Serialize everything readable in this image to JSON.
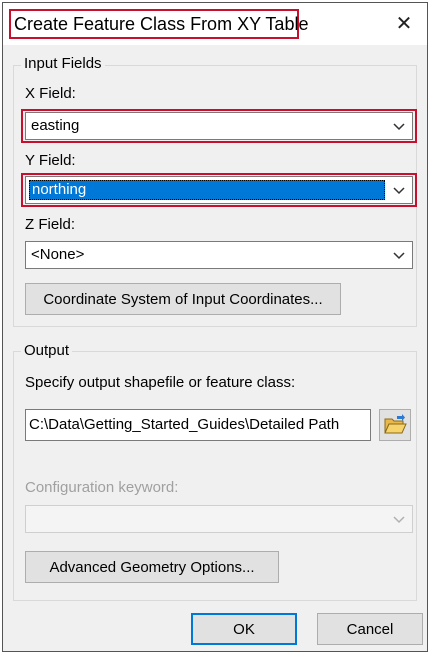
{
  "dialog": {
    "title": "Create Feature Class From XY Table",
    "close_glyph": "✕",
    "close_icon": "close-icon"
  },
  "input_fields": {
    "legend": "Input Fields",
    "x_field": {
      "label": "X Field:",
      "value": "easting"
    },
    "y_field": {
      "label": "Y Field:",
      "value": "northing"
    },
    "z_field": {
      "label": "Z Field:",
      "value": "<None>"
    },
    "coordinate_system_button": "Coordinate System of Input Coordinates..."
  },
  "output": {
    "legend": "Output",
    "instruction": "Specify output shapefile or feature class:",
    "path": "C:\\Data\\Getting_Started_Guides\\Detailed Path",
    "browse_icon": "open-folder-icon",
    "config_keyword_label": "Configuration keyword:",
    "config_keyword_value": "",
    "advanced_geometry_button": "Advanced Geometry Options..."
  },
  "footer": {
    "ok_label": "OK",
    "cancel_label": "Cancel"
  },
  "colors": {
    "annotation_red": "#c8102e",
    "selection_blue": "#0078d7",
    "dialog_background": "#f0f0f0"
  }
}
